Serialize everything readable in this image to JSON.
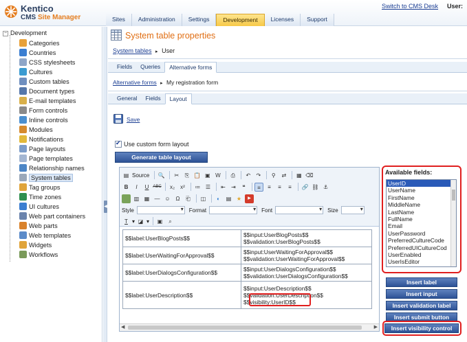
{
  "header": {
    "logo_line1": "Kentico",
    "logo_line2_prefix": "CMS ",
    "logo_line2_accent": "Site Manager",
    "switch_link": "Switch to CMS Desk",
    "user_label": "User:",
    "tabs": [
      {
        "label": "Sites"
      },
      {
        "label": "Administration"
      },
      {
        "label": "Settings"
      },
      {
        "label": "Development"
      },
      {
        "label": "Licenses"
      },
      {
        "label": "Support"
      }
    ]
  },
  "tree": {
    "root": "Development",
    "items": [
      {
        "label": "Categories",
        "color": "#e8a13a"
      },
      {
        "label": "Countries",
        "color": "#3b7ed1"
      },
      {
        "label": "CSS stylesheets",
        "color": "#8fa6c8"
      },
      {
        "label": "Cultures",
        "color": "#3b9bd1"
      },
      {
        "label": "Custom tables",
        "color": "#6f8fbf"
      },
      {
        "label": "Document types",
        "color": "#5577aa"
      },
      {
        "label": "E-mail templates",
        "color": "#d9b04a"
      },
      {
        "label": "Form controls",
        "color": "#8a8a8a"
      },
      {
        "label": "Inline controls",
        "color": "#4a8fd0"
      },
      {
        "label": "Modules",
        "color": "#d58a2e"
      },
      {
        "label": "Notifications",
        "color": "#e2b93b"
      },
      {
        "label": "Page layouts",
        "color": "#7b9cc9"
      },
      {
        "label": "Page templates",
        "color": "#a3b6d2"
      },
      {
        "label": "Relationship names",
        "color": "#4d86c6"
      },
      {
        "label": "System tables",
        "color": "#9aa8ba"
      },
      {
        "label": "Tag groups",
        "color": "#e0a43a"
      },
      {
        "label": "Time zones",
        "color": "#2f8f4e"
      },
      {
        "label": "UI cultures",
        "color": "#3b7ed1"
      },
      {
        "label": "Web part containers",
        "color": "#6b84ad"
      },
      {
        "label": "Web parts",
        "color": "#d9822b"
      },
      {
        "label": "Web templates",
        "color": "#5b8bc9"
      },
      {
        "label": "Widgets",
        "color": "#e0a43a"
      },
      {
        "label": "Workflows",
        "color": "#7a9a5a"
      }
    ],
    "selected": "System tables"
  },
  "main": {
    "title": "System table properties",
    "breadcrumb1": {
      "link": "System tables",
      "sep": "▸",
      "current": "User"
    },
    "tabs1": [
      {
        "label": "Fields"
      },
      {
        "label": "Queries"
      },
      {
        "label": "Alternative forms"
      }
    ],
    "breadcrumb2": {
      "link": "Alternative forms",
      "sep": "▸",
      "current": "My registration form"
    },
    "tabs2": [
      {
        "label": "General"
      },
      {
        "label": "Fields"
      },
      {
        "label": "Layout"
      }
    ],
    "save_label": "Save",
    "custom_layout_label": "Use custom form layout",
    "generate_button": "Generate table layout",
    "toolbar": {
      "source": "Source",
      "style": "Style",
      "format": "Format",
      "font": "Font",
      "size": "Size"
    },
    "layout_rows": [
      {
        "label": "$$label:UserBlogPosts$$",
        "content": [
          "$$input:UserBlogPosts$$",
          "$$validation:UserBlogPosts$$"
        ]
      },
      {
        "label": "$$label:UserWaitingForApproval$$",
        "content": [
          "$$input:UserWaitingForApproval$$",
          "$$validation:UserWaitingForApproval$$"
        ]
      },
      {
        "label": "$$label:UserDialogsConfiguration$$",
        "content": [
          "$$input:UserDialogsConfiguration$$",
          "$$validation:UserDialogsConfiguration$$"
        ]
      },
      {
        "label": "$$label:UserDescription$$",
        "content": [
          "$$input:UserDescription$$",
          "$$validation:UserDescription$$",
          "$$visibility:UserID$$"
        ]
      }
    ]
  },
  "available_fields": {
    "title": "Available fields:",
    "options": [
      "UserID",
      "UserName",
      "FirstName",
      "MiddleName",
      "LastName",
      "FullName",
      "Email",
      "UserPassword",
      "PreferredCultureCode",
      "PreferredUICultureCod",
      "UserEnabled",
      "UserIsEditor"
    ],
    "selected": "UserID"
  },
  "insert_buttons": {
    "label": "Insert label",
    "input": "Insert input",
    "validation": "Insert validation label",
    "submit": "Insert submit button",
    "visibility": "Insert visibility control"
  },
  "colors": {
    "accent_orange": "#e06e13",
    "button_blue": "#2d5296",
    "highlight_red": "#e01e1e",
    "active_tab": "#f7c948"
  }
}
